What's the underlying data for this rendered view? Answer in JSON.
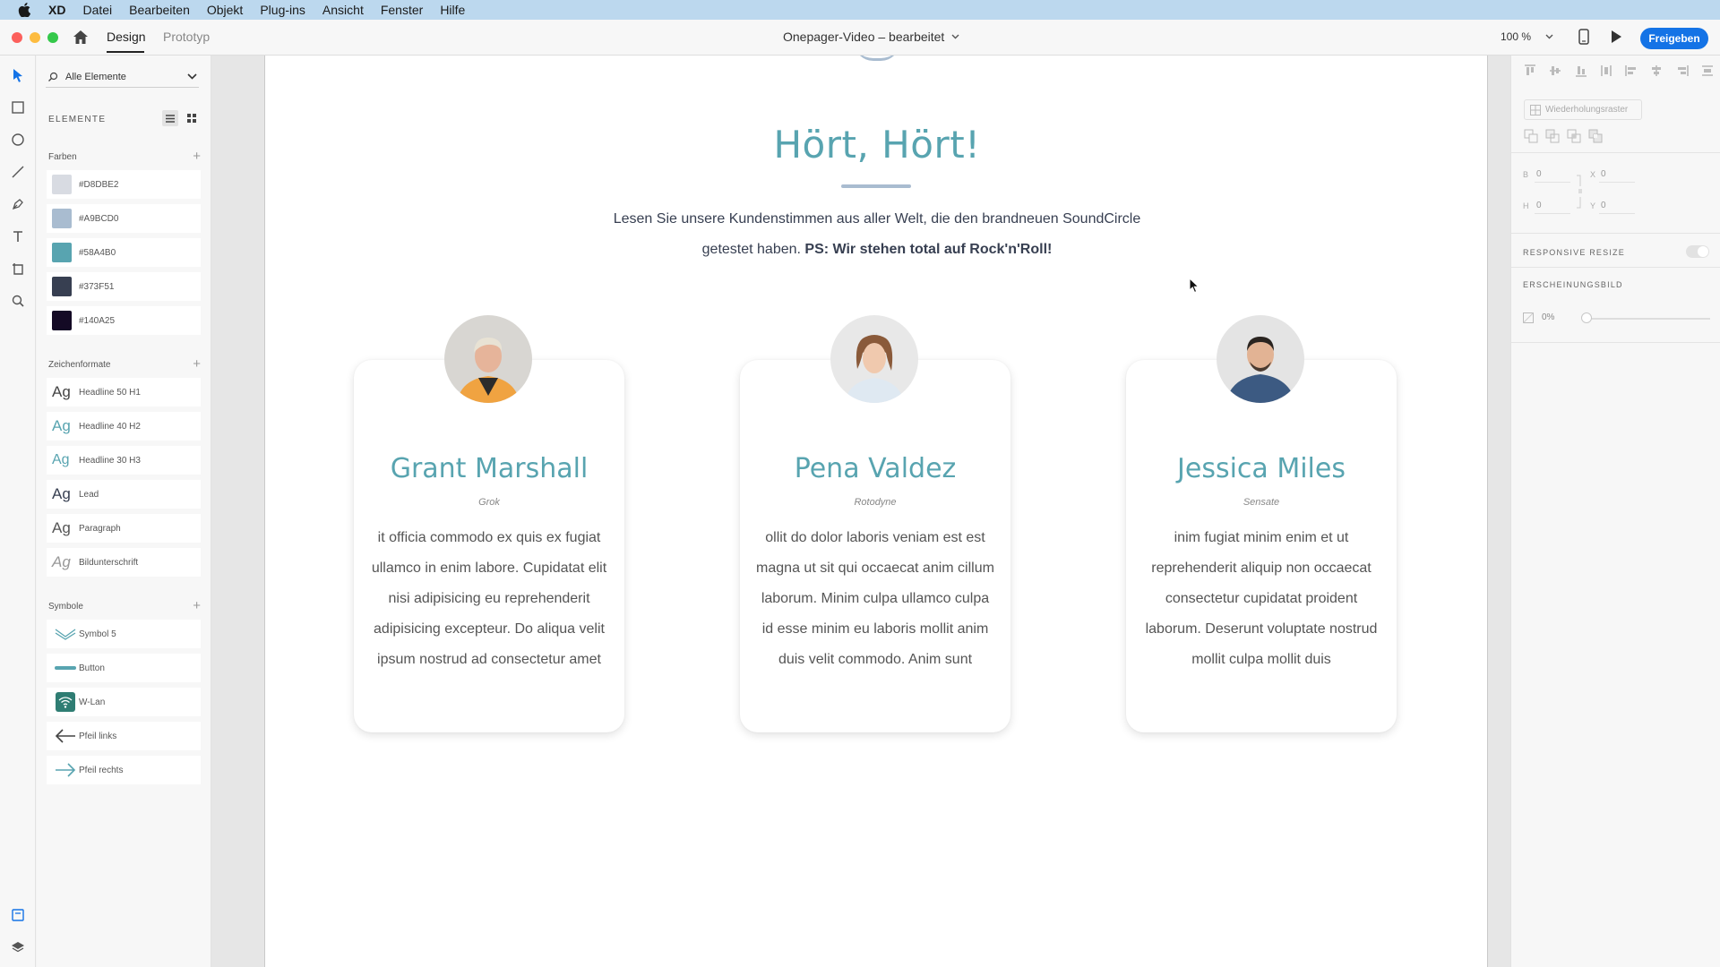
{
  "menubar": {
    "app": "XD",
    "items": [
      "Datei",
      "Bearbeiten",
      "Objekt",
      "Plug-ins",
      "Ansicht",
      "Fenster",
      "Hilfe"
    ]
  },
  "titlebar": {
    "tab_design": "Design",
    "tab_prototype": "Prototyp",
    "document_title": "Onepager-Video – bearbeitet",
    "zoom": "100 %",
    "share_label": "Freigeben"
  },
  "assets": {
    "search_label": "Alle Elemente",
    "heading": "ELEMENTE",
    "colors_heading": "Farben",
    "colors": [
      {
        "label": "#D8DBE2",
        "hex": "#D8DBE2"
      },
      {
        "label": "#A9BCD0",
        "hex": "#A9BCD0"
      },
      {
        "label": "#58A4B0",
        "hex": "#58A4B0"
      },
      {
        "label": "#373F51",
        "hex": "#373F51"
      },
      {
        "label": "#140A25",
        "hex": "#140A25"
      }
    ],
    "charstyles_heading": "Zeichenformate",
    "charstyles": [
      {
        "sample": "Ag",
        "label": "Headline 50 H1",
        "color": "#444444"
      },
      {
        "sample": "Ag",
        "label": "Headline 40 H2",
        "color": "#58A4B0"
      },
      {
        "sample": "Ag",
        "label": "Headline 30 H3",
        "color": "#58A4B0"
      },
      {
        "sample": "Ag",
        "label": "Lead",
        "color": "#373F51"
      },
      {
        "sample": "Ag",
        "label": "Paragraph",
        "color": "#555555"
      },
      {
        "sample": "Ag",
        "label": "Bildunterschrift",
        "color": "#999999"
      }
    ],
    "symbols_heading": "Symbole",
    "symbols": [
      {
        "label": "Symbol 5",
        "icon": "chevron-double-icon"
      },
      {
        "label": "Button",
        "icon": "button-bar-icon"
      },
      {
        "label": "W-Lan",
        "icon": "wifi-icon"
      },
      {
        "label": "Pfeil links",
        "icon": "arrow-left-icon"
      },
      {
        "label": "Pfeil rechts",
        "icon": "arrow-right-icon"
      }
    ]
  },
  "artboard": {
    "headline": "Hört, Hört!",
    "lead_plain": "Lesen Sie unsere Kundenstimmen aus aller Welt, die den brandneuen SoundCircle getestet haben.",
    "lead_bold": "PS: Wir stehen total auf Rock'n'Roll!",
    "cards": [
      {
        "name": "Grant Marshall",
        "company": "Grok",
        "text": "it officia commodo ex quis ex fugiat ullamco in enim labore. Cupidatat elit nisi adipisicing eu reprehenderit adipisicing excepteur. Do aliqua velit ipsum nostrud ad consectetur amet"
      },
      {
        "name": "Pena Valdez",
        "company": "Rotodyne",
        "text": "ollit do dolor laboris veniam est est magna ut sit qui occaecat anim cillum laborum. Minim culpa ullamco culpa id esse minim eu laboris mollit anim duis velit commodo. Anim sunt"
      },
      {
        "name": "Jessica Miles",
        "company": "Sensate",
        "text": "inim fugiat minim enim et ut reprehenderit aliquip non occaecat consectetur cupidatat proident laborum. Deserunt voluptate nostrud mollit culpa mollit duis"
      }
    ]
  },
  "properties": {
    "repeat_grid": "Wiederholungsraster",
    "b_label": "B",
    "b_value": "0",
    "x_label": "X",
    "x_value": "0",
    "h_label": "H",
    "h_value": "0",
    "y_label": "Y",
    "y_value": "0",
    "responsive_resize": "RESPONSIVE RESIZE",
    "appearance": "ERSCHEINUNGSBILD",
    "opacity": "0%"
  },
  "colors": {
    "accent": "#58A4B0",
    "share": "#1473E6"
  }
}
